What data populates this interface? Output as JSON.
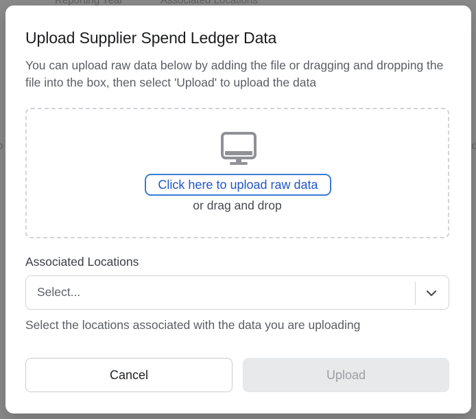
{
  "background": {
    "header_1": "Reporting Year",
    "header_2": "Associated Locations",
    "left_fragment": "o",
    "right_fragment": "d"
  },
  "modal": {
    "title": "Upload Supplier Spend Ledger Data",
    "description": "You can upload raw data below by adding the file or dragging and dropping the file into the box, then select 'Upload' to upload the data",
    "dropzone": {
      "icon": "monitor-icon",
      "link_label": "Click here to upload raw data",
      "drag_text": "or drag and drop"
    },
    "locations": {
      "label": "Associated Locations",
      "placeholder": "Select...",
      "helper": "Select the locations associated with the data you are uploading"
    },
    "actions": {
      "cancel_label": "Cancel",
      "upload_label": "Upload"
    }
  },
  "colors": {
    "link": "#2156c7",
    "focus_ring": "#3a7bd5",
    "disabled_bg": "#e8e9eb",
    "overlay": "#8a8a8a"
  }
}
